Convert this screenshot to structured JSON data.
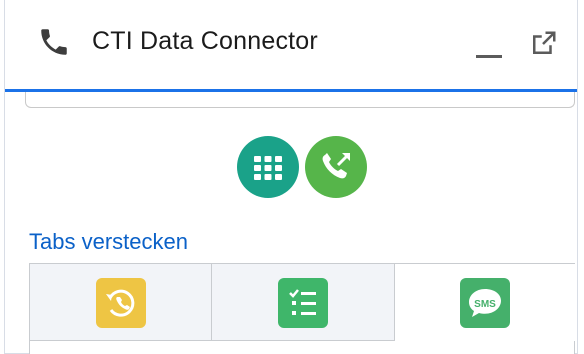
{
  "header": {
    "title": "CTI Data Connector",
    "phone_icon": "phone-icon",
    "minimize_icon": "minimize-icon",
    "popout_icon": "popout-icon",
    "accent_color": "#1b72e8"
  },
  "actions": {
    "keypad_icon": "dialpad-icon",
    "call_icon": "outgoing-call-icon"
  },
  "tabs_link": {
    "label": "Tabs verstecken"
  },
  "tabs": [
    {
      "icon": "call-history-icon",
      "color": "#eec544"
    },
    {
      "icon": "task-list-icon",
      "color": "#3fb66a"
    },
    {
      "icon": "sms-icon",
      "label": "SMS",
      "color": "#45b06b",
      "selected": true
    }
  ]
}
